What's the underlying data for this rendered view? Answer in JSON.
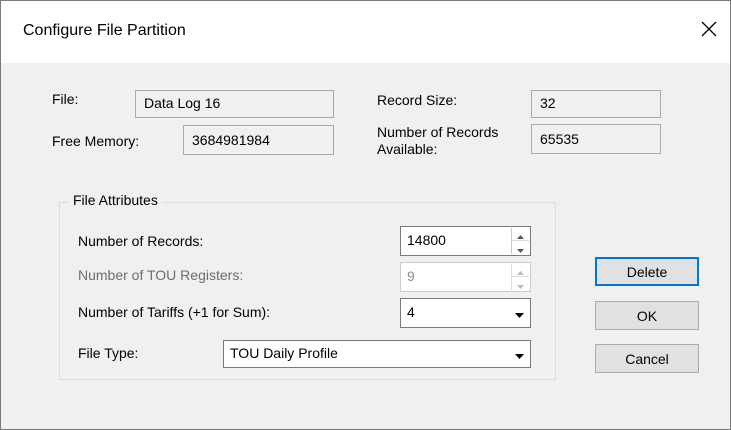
{
  "dialog": {
    "title": "Configure File Partition",
    "close_glyph": "✕"
  },
  "info": {
    "file_label": "File:",
    "file_value": "Data Log 16",
    "free_memory_label": "Free Memory:",
    "free_memory_value": "3684981984",
    "record_size_label": "Record Size:",
    "record_size_value": "32",
    "records_available_label_line1": "Number of Records",
    "records_available_label_line2": "Available:",
    "records_available_value": "65535"
  },
  "attributes": {
    "group_title": "File Attributes",
    "num_records_label": "Number of Records:",
    "num_records_value": "14800",
    "num_tou_label": "Number of TOU Registers:",
    "num_tou_value": "9",
    "num_tariffs_label": "Number of Tariffs (+1 for Sum):",
    "num_tariffs_value": "4",
    "file_type_label": "File Type:",
    "file_type_value": "TOU Daily Profile"
  },
  "buttons": {
    "delete": "Delete",
    "ok": "OK",
    "cancel": "Cancel"
  },
  "colors": {
    "focus_border": "#0078d7",
    "dialog_bg": "#f0f0f0"
  }
}
